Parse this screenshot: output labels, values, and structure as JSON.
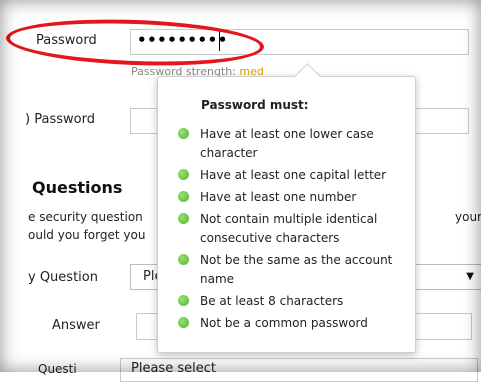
{
  "password_row": {
    "label": "Password",
    "masked_value": "•••••••••",
    "strength_prefix": "Password strength:",
    "strength_level": "med"
  },
  "confirm_row": {
    "label": "Password"
  },
  "security": {
    "title": "Questions",
    "description_line1": "e security question",
    "description_line2": "ould you forget you",
    "description_tail": "your",
    "question_label": "y Question",
    "question_select_value": "Ple",
    "answer_label": "Answer",
    "next_select_value": "Please select",
    "next_label": "Questi"
  },
  "popup": {
    "title": "Password must:",
    "rules": [
      "Have at least one lower case character",
      "Have at least one capital letter",
      "Have at least one number",
      "Not contain multiple identical consecutive characters",
      "Not be the same as the account name",
      "Be at least 8 characters",
      "Not be a common password"
    ]
  },
  "colors": {
    "rule_ok": "#4eb52a",
    "annotation_oval": "#e4161b",
    "strength_med": "#d9a400"
  }
}
